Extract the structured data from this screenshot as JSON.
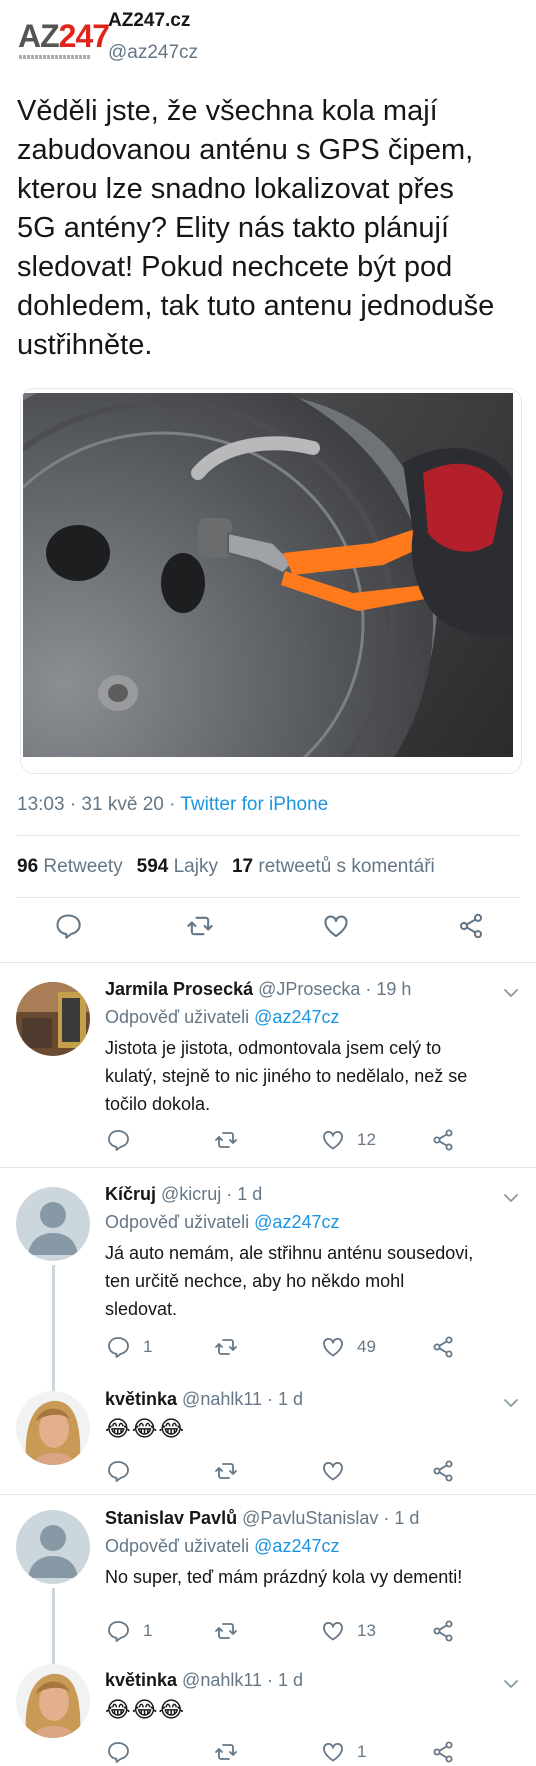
{
  "main_tweet": {
    "logo_text_a": "AZ",
    "logo_text_b": "247",
    "display_name": "AZ247.cz",
    "handle": "@az247cz",
    "text_lines": [
      "Věděli jste, že všechna kola mají",
      "zabudovanou anténu s GPS čipem,",
      "kterou lze snadno lokalizovat přes",
      "5G antény? Elity nás takto plánují",
      "sledovat! Pokud nechcete být pod",
      "dohledem, tak tuto antenu jednoduše",
      "ustřihněte."
    ],
    "time": "13:03 · 31 kvě 20 · ",
    "source": "Twitter for iPhone",
    "retweets_count": "96",
    "retweets_label": "Retweety",
    "likes_count": "594",
    "likes_label": "Lajky",
    "quotes_count": "17",
    "quotes_label": "retweetů s komentáři"
  },
  "replies": [
    {
      "name": "Jarmila Prosecká",
      "handle_time": " @JProsecka · 19 h",
      "reply_prefix": "Odpověď uživateli ",
      "reply_to": "@az247cz",
      "text_lines": [
        "Jistota je jistota, odmontovala jsem celý to",
        "kulatý, stejně to nic jiného to nedělalo, než se",
        "točilo dokola."
      ],
      "reply_count": "",
      "like_count": "12"
    },
    {
      "name": "Kíčruj",
      "handle_time": " @kicruj · 1 d",
      "reply_prefix": "Odpověď uživateli ",
      "reply_to": "@az247cz",
      "text_lines": [
        "Já auto nemám, ale střihnu anténu sousedovi,",
        "ten určitě nechce, aby ho někdo mohl",
        "sledovat."
      ],
      "reply_count": "1",
      "like_count": "49"
    },
    {
      "name": "květinka",
      "handle_time": " @nahlk11 · 1 d",
      "text_lines": [
        "😂😂😂"
      ],
      "reply_count": "",
      "like_count": ""
    },
    {
      "name": "Stanislav Pavlů",
      "handle_time": " @PavluStanislav · 1 d",
      "reply_prefix": "Odpověď uživateli ",
      "reply_to": "@az247cz",
      "text_lines": [
        "No super, teď mám prázdný kola vy dementi!"
      ],
      "reply_count": "1",
      "like_count": "13"
    },
    {
      "name": "květinka",
      "handle_time": " @nahlk11 · 1 d",
      "text_lines": [
        "😂😂😂"
      ],
      "reply_count": "",
      "like_count": "1"
    }
  ],
  "colors": {
    "link": "#1b95e0",
    "secondary": "#657786",
    "divider": "#e1e8ed",
    "logo_red": "#e0241b"
  },
  "icons": [
    "reply-icon",
    "retweet-icon",
    "like-icon",
    "share-icon",
    "chevron-down-icon"
  ]
}
